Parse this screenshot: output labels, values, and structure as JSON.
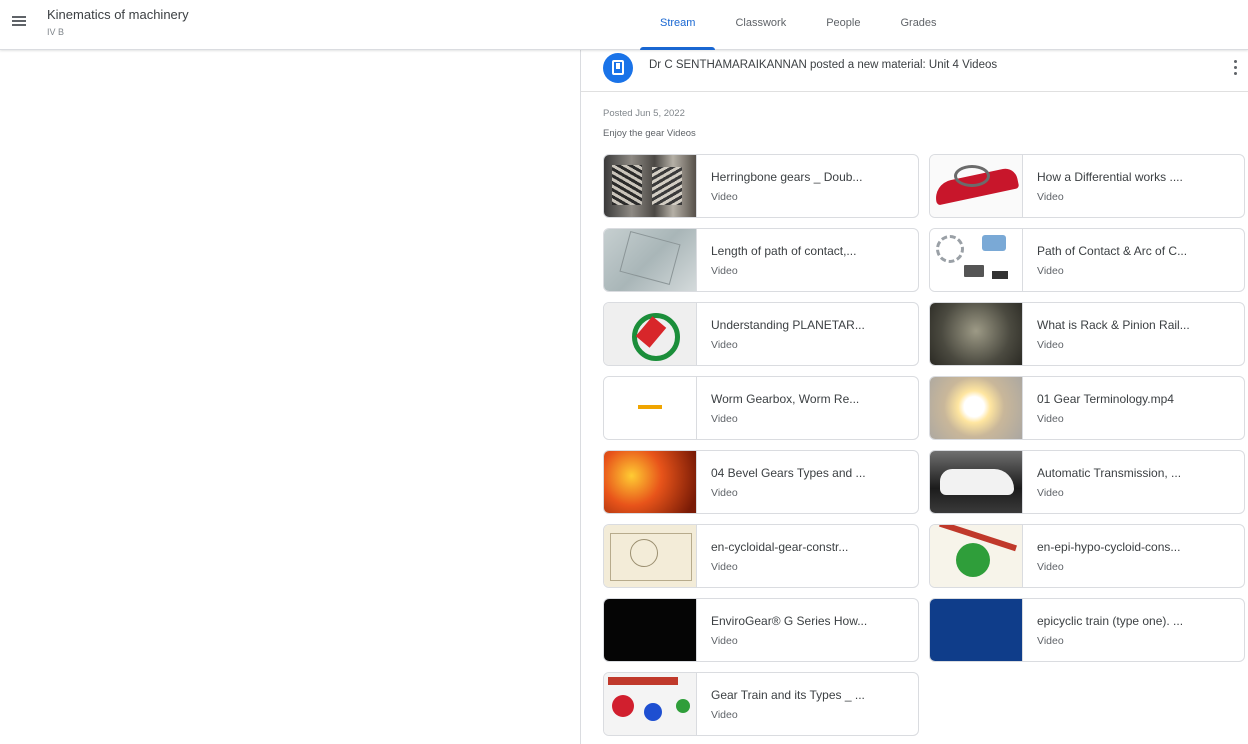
{
  "header": {
    "class_title": "Kinematics of machinery",
    "class_section": "IV B",
    "tabs": [
      {
        "label": "Stream",
        "active": true
      },
      {
        "label": "Classwork",
        "active": false
      },
      {
        "label": "People",
        "active": false
      },
      {
        "label": "Grades",
        "active": false
      }
    ]
  },
  "post": {
    "title": "Dr C SENTHAMARAIKANNAN posted a new material: Unit 4 Videos",
    "posted_date": "Posted Jun 5, 2022",
    "description": "Enjoy the gear Videos",
    "accent_color": "#1a73e8",
    "materials": [
      {
        "title": "Herringbone gears _ Doub...",
        "type": "Video"
      },
      {
        "title": "How a Differential works ....",
        "type": "Video"
      },
      {
        "title": "Length of path of contact,...",
        "type": "Video"
      },
      {
        "title": "Path of Contact & Arc of C...",
        "type": "Video"
      },
      {
        "title": "Understanding PLANETAR...",
        "type": "Video"
      },
      {
        "title": "What is Rack & Pinion Rail...",
        "type": "Video"
      },
      {
        "title": "Worm Gearbox, Worm Re...",
        "type": "Video"
      },
      {
        "title": "01 Gear Terminology.mp4",
        "type": "Video"
      },
      {
        "title": "04 Bevel Gears Types and ...",
        "type": "Video"
      },
      {
        "title": "Automatic Transmission, ...",
        "type": "Video"
      },
      {
        "title": "en-cycloidal-gear-constr...",
        "type": "Video"
      },
      {
        "title": "en-epi-hypo-cycloid-cons...",
        "type": "Video"
      },
      {
        "title": "EnviroGear® G Series How...",
        "type": "Video"
      },
      {
        "title": "epicyclic train (type one). ...",
        "type": "Video"
      },
      {
        "title": "Gear Train and its Types _ ...",
        "type": "Video"
      }
    ]
  }
}
